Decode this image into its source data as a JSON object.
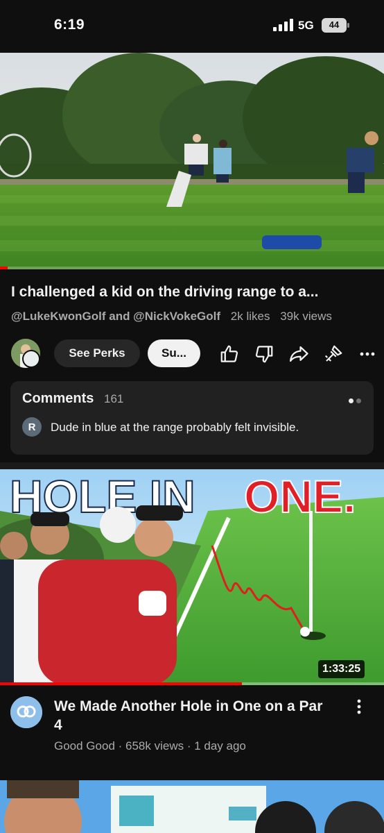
{
  "status_bar": {
    "time": "6:19",
    "network": "5G",
    "battery": "44"
  },
  "player": {
    "progress_fraction": 0.02
  },
  "video": {
    "title": "I challenged a kid on the driving range to a...",
    "channels": "@LukeKwonGolf and @NickVokeGolf",
    "likes": "2k likes",
    "views": "39k views"
  },
  "actions": {
    "perks_label": "See Perks",
    "subscribe_label": "Su..."
  },
  "comments": {
    "label": "Comments",
    "count": "161",
    "first_comment_avatar": "R",
    "first_comment": "Dude in blue at the range probably felt invisible."
  },
  "next_video": {
    "thumbnail_text_1": "HOLE IN",
    "thumbnail_text_2": "ONE.",
    "duration": "1:33:25",
    "title": "We Made Another Hole in One on a Par 4",
    "meta": "Good Good · 658k views · 1 day ago",
    "watched_fraction": 0.63
  },
  "colors": {
    "accent": "#ff0000",
    "background": "#0f0f0f",
    "card": "#212121"
  }
}
